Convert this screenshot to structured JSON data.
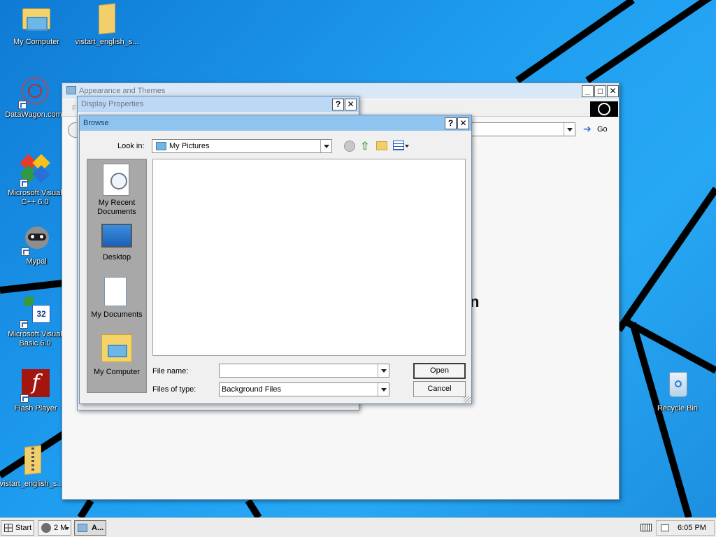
{
  "desktop": {
    "icons": [
      {
        "label": "My Computer"
      },
      {
        "label": "vistart_english_s..."
      },
      {
        "label": "DataWagon.com"
      },
      {
        "label": "Microsoft Visual\nC++ 6.0"
      },
      {
        "label": "Mypal"
      },
      {
        "label": "Microsoft Visual\nBasic 6.0"
      },
      {
        "label": "Flash Player"
      },
      {
        "label": "vistart_english_s..."
      },
      {
        "label": "Recycle Bin"
      }
    ]
  },
  "appearance_window": {
    "title": "Appearance and Themes",
    "menu_first_letter": "Fi",
    "go_label": "Go",
    "partial_text": "n"
  },
  "display_properties": {
    "title": "Display Properties"
  },
  "browse_dialog": {
    "title": "Browse",
    "look_in_label": "Look in:",
    "look_in_value": "My Pictures",
    "places": [
      {
        "label": "My Recent\nDocuments"
      },
      {
        "label": "Desktop"
      },
      {
        "label": "My Documents"
      },
      {
        "label": "My Computer"
      }
    ],
    "file_name_label": "File name:",
    "file_name_value": "",
    "files_of_type_label": "Files of type:",
    "files_of_type_value": "Background Files",
    "open_label": "Open",
    "cancel_label": "Cancel"
  },
  "taskbar": {
    "start_label": "Start",
    "group_label": "2 M",
    "active_label": "A...",
    "clock": "6:05 PM"
  }
}
